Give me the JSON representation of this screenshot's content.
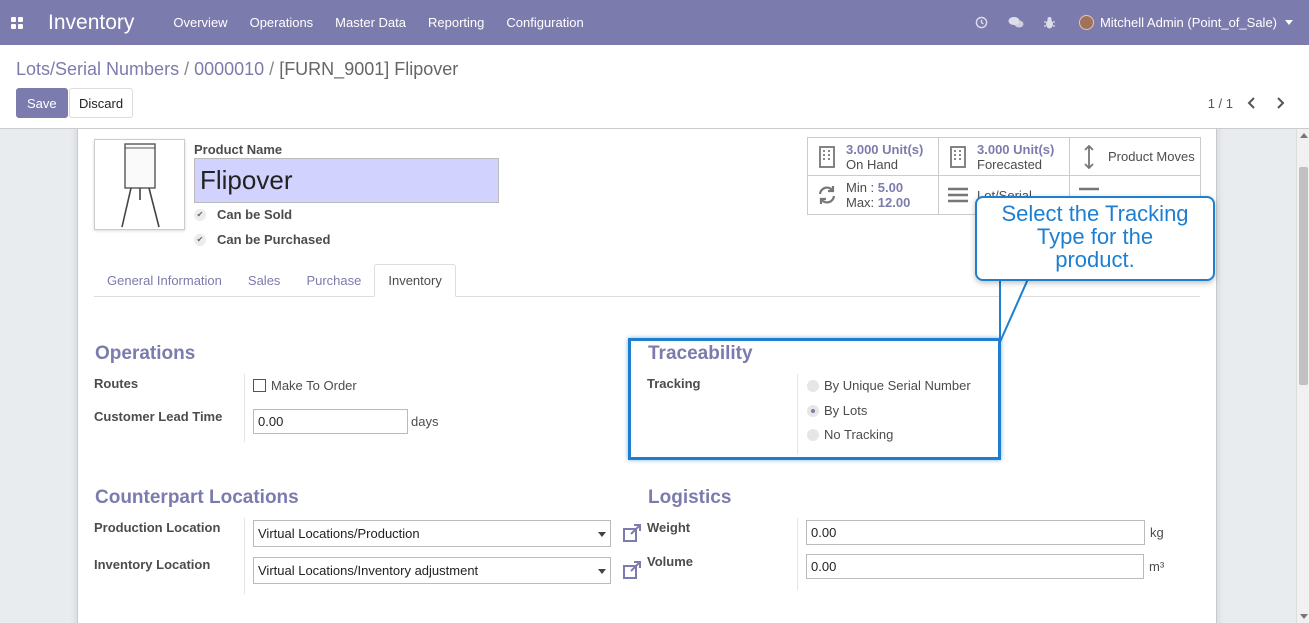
{
  "navbar": {
    "app_name": "Inventory",
    "menu": [
      "Overview",
      "Operations",
      "Master Data",
      "Reporting",
      "Configuration"
    ],
    "user": "Mitchell Admin (Point_of_Sale)",
    "icons": [
      "apps-icon",
      "clock-icon",
      "chat-icon",
      "bug-icon"
    ]
  },
  "breadcrumb": {
    "items": [
      "Lots/Serial Numbers",
      "0000010",
      "[FURN_9001] Flipover"
    ],
    "separator": "/"
  },
  "buttons": {
    "save": "Save",
    "discard": "Discard"
  },
  "pager": {
    "text": "1 / 1"
  },
  "product": {
    "name_label": "Product Name",
    "name_value": "Flipover",
    "can_be_sold": "Can be Sold",
    "can_be_purchased": "Can be Purchased"
  },
  "smart_buttons": {
    "on_hand_value": "3.000",
    "on_hand_unit": "Unit(s)",
    "on_hand_label": "On Hand",
    "forecast_value": "3.000",
    "forecast_unit": "Unit(s)",
    "forecast_label": "Forecasted",
    "moves_label": "Product Moves",
    "min_label": "Min :",
    "min_value": "5.00",
    "max_label": "Max:",
    "max_value": "12.00",
    "lot_label": "Lot/Serial"
  },
  "tabs": [
    "General Information",
    "Sales",
    "Purchase",
    "Inventory"
  ],
  "active_tab": "Inventory",
  "operations": {
    "title": "Operations",
    "routes_label": "Routes",
    "route_option": "Make To Order",
    "lead_time_label": "Customer Lead Time",
    "lead_time_value": "0.00",
    "lead_time_unit": "days"
  },
  "traceability": {
    "title": "Traceability",
    "tracking_label": "Tracking",
    "options": [
      "By Unique Serial Number",
      "By Lots",
      "No Tracking"
    ],
    "selected": "By Lots"
  },
  "counterpart": {
    "title": "Counterpart Locations",
    "production_label": "Production Location",
    "production_value": "Virtual Locations/Production",
    "inventory_label": "Inventory Location",
    "inventory_value": "Virtual Locations/Inventory adjustment"
  },
  "logistics": {
    "title": "Logistics",
    "weight_label": "Weight",
    "weight_value": "0.00",
    "weight_unit": "kg",
    "volume_label": "Volume",
    "volume_value": "0.00",
    "volume_unit": "m³"
  },
  "tour": {
    "tip": "Select the Tracking Type for the product.",
    "color": "#1e7fd1"
  },
  "colors": {
    "brand": "#7c7bad",
    "input_highlight": "#d2d2ff"
  }
}
